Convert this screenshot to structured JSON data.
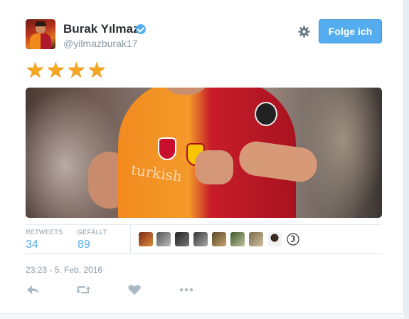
{
  "tweet": {
    "display_name": "Burak Yılmaz",
    "username": "@yilmazburak17",
    "follow_label": "Folge ich",
    "stars": "★★★★",
    "image_sponsor_text": "turkish"
  },
  "stats": {
    "retweets_label": "RETWEETS",
    "retweets_count": "34",
    "likes_label": "GEFÄLLT",
    "likes_count": "89"
  },
  "timestamp": "23:23 - 5. Feb. 2016",
  "colors": {
    "accent": "#55acee",
    "muted": "#8899a6",
    "star": "#f5a623"
  },
  "icons": {
    "verified": "verified-badge-icon",
    "settings": "gear-icon",
    "reply": "reply-icon",
    "retweet": "retweet-icon",
    "like": "heart-icon",
    "more": "more-icon"
  }
}
